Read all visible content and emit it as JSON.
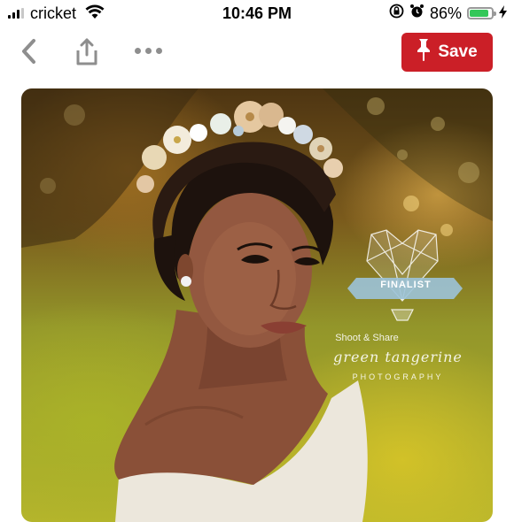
{
  "status_bar": {
    "carrier": "cricket",
    "time": "10:46 PM",
    "battery_percent": "86%",
    "battery_level": 0.86,
    "battery_color": "#34c759",
    "icons": [
      "signal-icon",
      "wifi-icon",
      "orientation-lock-icon",
      "alarm-icon",
      "battery-icon",
      "charging-icon"
    ]
  },
  "toolbar": {
    "back_icon": "chevron-left-icon",
    "share_icon": "share-icon",
    "more_icon": "more-icon",
    "save_label": "Save",
    "save_color": "#cb1f27",
    "pin_icon": "pin-icon"
  },
  "pin_image": {
    "watermark": {
      "badge": "FINALIST",
      "shoot_text": "Shoot & Share",
      "brand": "green tangerine",
      "sub": "PHOTOGRAPHY"
    }
  }
}
